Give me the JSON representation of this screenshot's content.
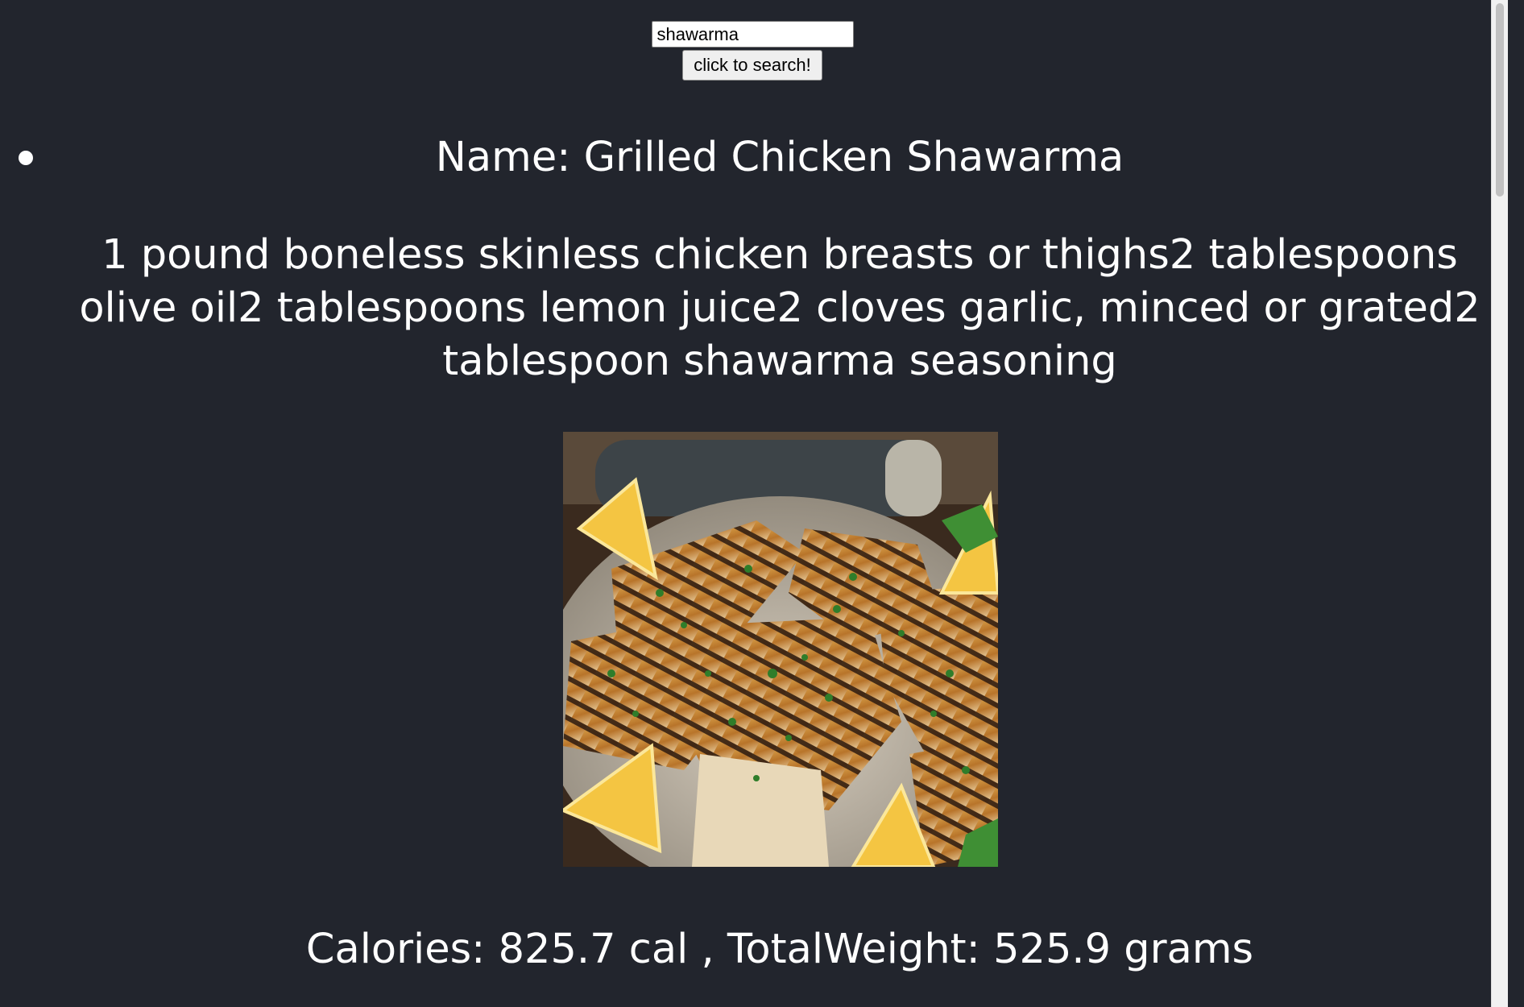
{
  "search": {
    "value": "shawarma",
    "button_label": "click to search!"
  },
  "results": [
    {
      "name": "Name: Grilled Chicken Shawarma",
      "ingredients": "1 pound boneless skinless chicken breasts or thighs2 tablespoons olive oil2 tablespoons lemon juice2 cloves garlic, minced or grated2 tablespoon shawarma seasoning",
      "image_icon": "grilled-chicken-photo",
      "nutrition": "Calories: 825.7 cal , TotalWeight: 525.9 grams"
    }
  ],
  "colors": {
    "background": "#22252d",
    "text": "#ffffff"
  }
}
